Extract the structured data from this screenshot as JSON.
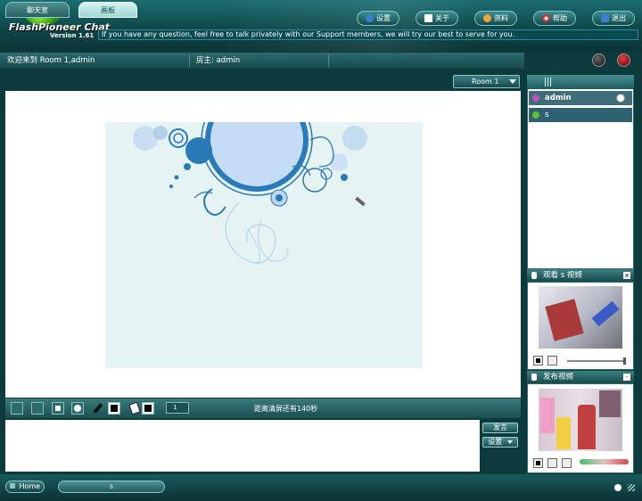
{
  "app": {
    "title": "FlashPioneer Chat",
    "version": "Version 1.61"
  },
  "header": {
    "buttons": [
      {
        "label": "设置",
        "icon": "gear-icon"
      },
      {
        "label": "关于",
        "icon": "pencil-icon"
      },
      {
        "label": "资料",
        "icon": "user-icon"
      },
      {
        "label": "帮助",
        "icon": "lifebuoy-icon"
      },
      {
        "label": "退出",
        "icon": "exit-icon"
      }
    ],
    "marquee": "If you have any question, feel free to talk privately with our Support members, we will try our best to serve for you."
  },
  "infobar": {
    "welcome": "欢迎来到 Room 1,admin",
    "host": "房主: admin"
  },
  "tabs": [
    {
      "label": "聊天室"
    },
    {
      "label": "画板"
    }
  ],
  "room_select": {
    "value": "Room 1"
  },
  "toolbar": {
    "clear_notice": "距离清屏还有140秒",
    "line_size": "1"
  },
  "message": {
    "send_label": "发言",
    "settings_label": "设置"
  },
  "users": [
    {
      "name": "admin",
      "status_color": "#c04fc0"
    },
    {
      "name": "s",
      "status_color": "#5fbf2f"
    }
  ],
  "watch_panel": {
    "title": "观看 s 视频",
    "close": "x"
  },
  "publish_panel": {
    "title": "发布视频",
    "minimize": "-"
  },
  "footer": {
    "home_label": "Home",
    "status_user": "s"
  },
  "colors": {
    "accent": "#1a5052",
    "header_dark": "#0e4446",
    "drawing_bg": "#e6f3f3",
    "swirl_blue": "#2a7ab8"
  }
}
